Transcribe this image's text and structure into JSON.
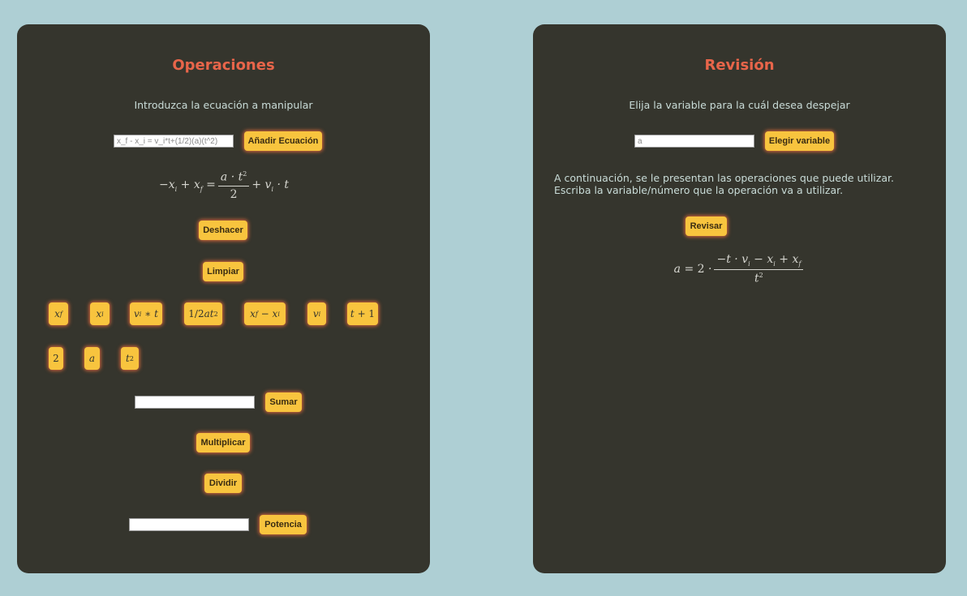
{
  "left_panel": {
    "title": "Operaciones",
    "prompt": "Introduzca la ecuación a manipular",
    "equation_input": {
      "value": "",
      "placeholder": "x_f - x_i = v_i*t+(1/2)(a)(t^2)"
    },
    "add_button": "Añadir Ecuación",
    "undo_button": "Deshacer",
    "clear_button": "Limpiar",
    "tokens_row1": [
      "x_f",
      "x_i",
      "v_i * t",
      "1/2at^2",
      "x_f - x_i",
      "v_i",
      "t + 1"
    ],
    "tokens_row2": [
      "2",
      "a",
      "t^2"
    ],
    "sum_input": {
      "value": "",
      "placeholder": ""
    },
    "sum_button": "Sumar",
    "multiply_button": "Multiplicar",
    "divide_button": "Dividir",
    "power_input": {
      "value": "",
      "placeholder": ""
    },
    "power_button": "Potencia",
    "equation": "-x_i + x_f = (a · t^2)/2 + v_i · t"
  },
  "right_panel": {
    "title": "Revisión",
    "prompt": "Elija la variable para la cuál desea despejar",
    "variable_input": {
      "value": "",
      "placeholder": "a"
    },
    "choose_button": "Elegir variable",
    "info_text": "A continuación, se le presentan las operaciones que puede utilizar. Escriba la variable/número que la operación va a utilizar.",
    "review_button": "Revisar",
    "result": "a = 2 · (-t · v_i - x_i + x_f)/t^2"
  },
  "colors": {
    "background": "#aecfd4",
    "panel": "#35352d",
    "title": "#e8654a",
    "button": "#f8c43e",
    "button_glow": "#e0693c"
  }
}
